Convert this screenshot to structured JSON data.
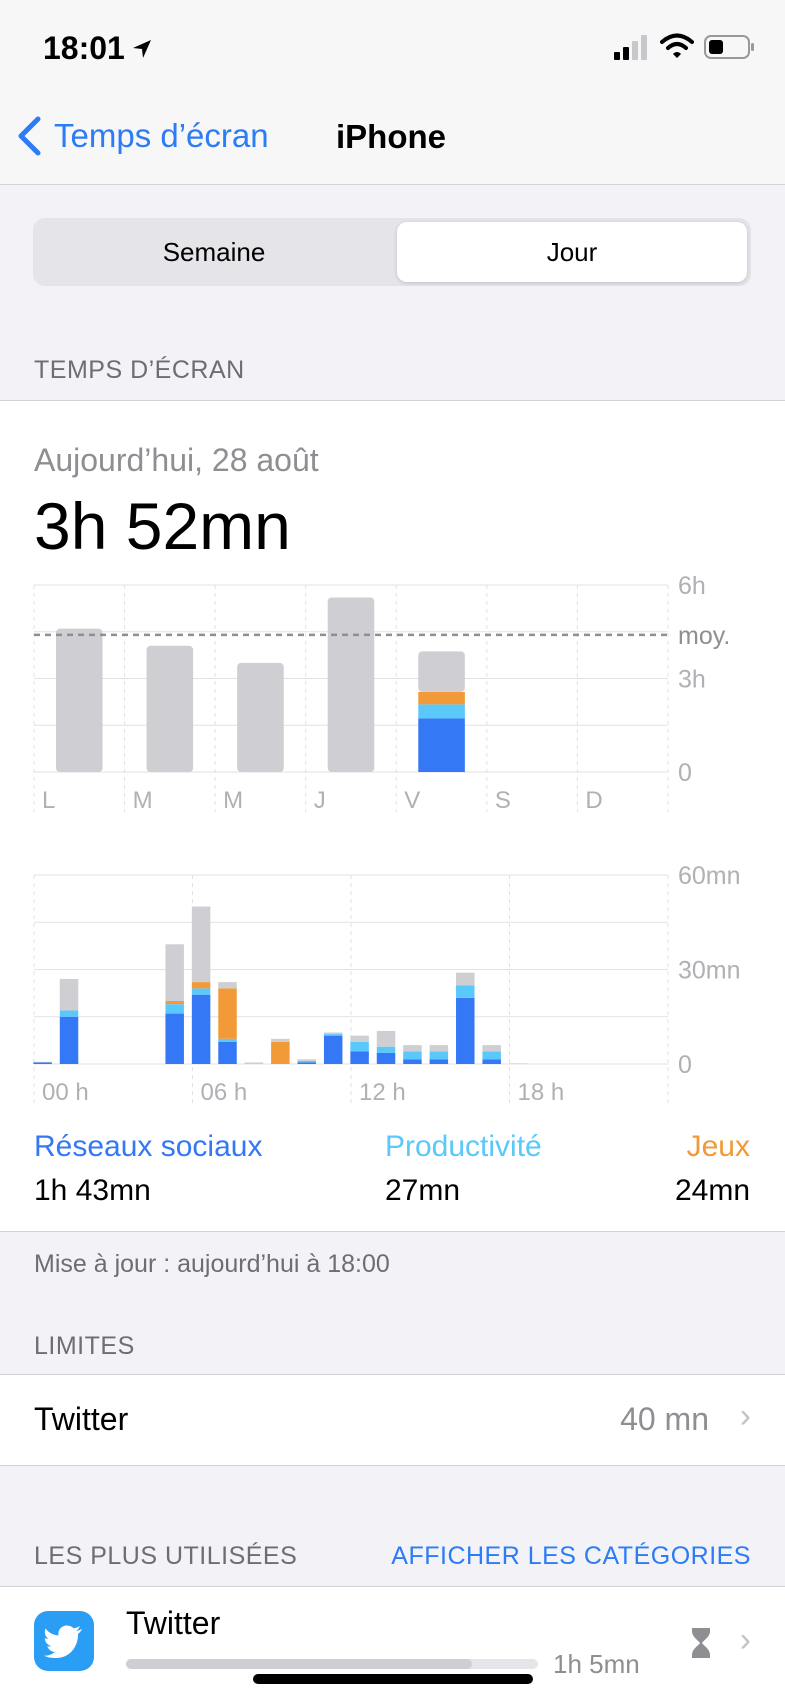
{
  "status_bar": {
    "time": "18:01"
  },
  "nav": {
    "back_label": "Temps d’écran",
    "title": "iPhone"
  },
  "segment": {
    "options": [
      "Semaine",
      "Jour"
    ],
    "selected": "Jour"
  },
  "screen_time": {
    "section_header": "TEMPS D’ÉCRAN",
    "date": "Aujourd’hui, 28 août",
    "total": "3h 52mn",
    "categories": [
      {
        "name": "Réseaux sociaux",
        "value": "1h 43mn",
        "color": "#3478f6"
      },
      {
        "name": "Productivité",
        "value": "27mn",
        "color": "#5ac8fa"
      },
      {
        "name": "Jeux",
        "value": "24mn",
        "color": "#f19a37"
      }
    ],
    "updated": "Mise à jour : aujourd’hui à 18:00"
  },
  "limits": {
    "header": "LIMITES",
    "item": {
      "name": "Twitter",
      "value": "40 mn"
    }
  },
  "most_used": {
    "header": "LES PLUS UTILISÉES",
    "link": "AFFICHER LES CATÉGORIES",
    "item": {
      "name": "Twitter",
      "value": "1h 5mn",
      "usage_fraction": 0.84
    }
  },
  "colors": {
    "social": "#3478f6",
    "productivity": "#5ac8fa",
    "games": "#f19a37",
    "other": "#cfcfd3",
    "link": "#2b7cf6"
  },
  "chart_data": [
    {
      "type": "bar",
      "categories": [
        "L",
        "M",
        "M",
        "J",
        "V",
        "S",
        "D"
      ],
      "y_ticks": [
        "6h",
        "3h",
        "0"
      ],
      "average_label": "moy.",
      "average": 4.4,
      "ylim": [
        0,
        6
      ],
      "units": "h",
      "series": [
        {
          "values": [
            0,
            0,
            0,
            0,
            1.72,
            0,
            0
          ]
        },
        {
          "values": [
            0,
            0,
            0,
            0,
            0.45,
            0,
            0
          ]
        },
        {
          "values": [
            0,
            0,
            0,
            0,
            0.4,
            0,
            0
          ]
        },
        {
          "values": [
            4.6,
            4.05,
            3.5,
            5.6,
            1.3,
            0,
            0
          ]
        }
      ]
    },
    {
      "type": "bar",
      "categories": [
        "00 h",
        "06 h",
        "12 h",
        "18 h"
      ],
      "y_ticks": [
        "60mn",
        "30mn",
        "0"
      ],
      "ylim": [
        0,
        60
      ],
      "units": "mn",
      "hours": [
        0,
        1,
        2,
        3,
        4,
        5,
        6,
        7,
        8,
        9,
        10,
        11,
        12,
        13,
        14,
        15,
        16,
        17
      ],
      "series": [
        {
          "values": [
            0,
            15,
            0,
            0,
            0,
            0,
            0,
            0,
            0,
            0,
            0,
            0,
            0,
            0,
            0,
            0,
            0,
            0
          ]
        },
        {
          "values": [
            0,
            2,
            0,
            0,
            0,
            0,
            0,
            0,
            0,
            0,
            0,
            0,
            0,
            0,
            0,
            0,
            0,
            0
          ]
        },
        {
          "values": [
            0,
            0,
            0,
            0,
            0,
            0,
            0,
            0,
            0,
            0,
            0,
            0,
            0,
            0,
            0,
            0,
            0,
            0
          ]
        },
        {
          "values": [
            0.6,
            10,
            0,
            0,
            0,
            0,
            0,
            0,
            0,
            0,
            0,
            0,
            0,
            0,
            0,
            0,
            0,
            0
          ]
        }
      ],
      "half_hour_bars": [
        {
          "t": 0.25,
          "social": 0.5,
          "productivity": 0,
          "games": 0,
          "other": 0.2
        },
        {
          "t": 1.25,
          "social": 15,
          "productivity": 2,
          "games": 0,
          "other": 10
        },
        {
          "t": 5.25,
          "social": 16,
          "productivity": 3,
          "games": 1,
          "other": 18
        },
        {
          "t": 6.25,
          "social": 22,
          "productivity": 2,
          "games": 2,
          "other": 24
        },
        {
          "t": 7.25,
          "social": 7,
          "productivity": 1,
          "games": 16,
          "other": 2
        },
        {
          "t": 8.25,
          "social": 0,
          "productivity": 0,
          "games": 0,
          "other": 0.5
        },
        {
          "t": 9.25,
          "social": 0,
          "productivity": 0,
          "games": 7,
          "other": 1
        },
        {
          "t": 10.25,
          "social": 0.5,
          "productivity": 0.5,
          "games": 0,
          "other": 0.5
        },
        {
          "t": 11.25,
          "social": 9,
          "productivity": 0.5,
          "games": 0,
          "other": 0.5
        },
        {
          "t": 12.25,
          "social": 4,
          "productivity": 3,
          "games": 0,
          "other": 2
        },
        {
          "t": 13.25,
          "social": 3.5,
          "productivity": 2,
          "games": 0,
          "other": 5
        },
        {
          "t": 14.25,
          "social": 1.5,
          "productivity": 2.5,
          "games": 0,
          "other": 2
        },
        {
          "t": 15.25,
          "social": 1.5,
          "productivity": 2.5,
          "games": 0,
          "other": 2
        },
        {
          "t": 16.25,
          "social": 21,
          "productivity": 4,
          "games": 0,
          "other": 4
        },
        {
          "t": 17.25,
          "social": 1.5,
          "productivity": 2.5,
          "games": 0,
          "other": 2
        },
        {
          "t": 18.25,
          "social": 0,
          "productivity": 0,
          "games": 0,
          "other": 0.2
        }
      ]
    }
  ]
}
